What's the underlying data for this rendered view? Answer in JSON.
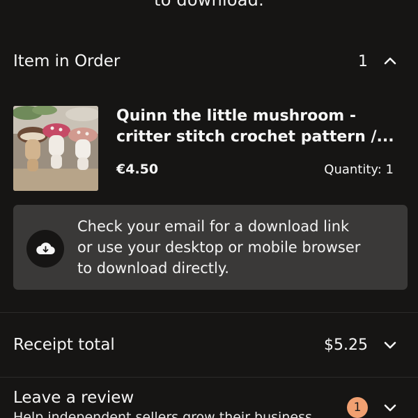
{
  "top_text": "to download.",
  "order_section": {
    "title": "Item in Order",
    "count": "1"
  },
  "item": {
    "title_line1": "Quinn the little mushroom -",
    "title_line2": "critter stitch crochet pattern /...",
    "price": "€4.50",
    "quantity": "Quantity: 1"
  },
  "download_notice": {
    "line1": "Check your email for a download link",
    "line2": "or use your desktop or mobile browser",
    "line3": "to download directly.",
    "icon": "cloud-download-icon"
  },
  "receipt": {
    "label": "Receipt total",
    "total": "$5.25"
  },
  "review": {
    "label": "Leave a review",
    "badge": "1",
    "subtext": "Help independent sellers grow their business"
  },
  "colors": {
    "background": "#161514",
    "card": "#3a3938",
    "badge": "#f1a071",
    "text": "#f5f5f5"
  }
}
